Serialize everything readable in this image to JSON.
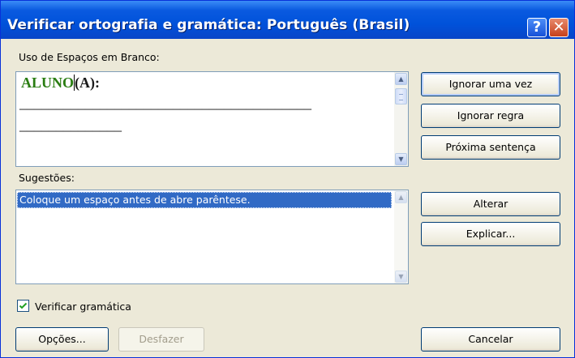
{
  "window": {
    "title": "Verificar ortografia e gramática: Português (Brasil)",
    "help_glyph": "?",
    "close_glyph": "✕"
  },
  "whitespace_section": {
    "label": "Uso de Espaços em Branco:",
    "text_word": "ALUNO",
    "text_rest": "(A):",
    "line1": "________________________________________",
    "line2": "______________"
  },
  "suggestions": {
    "label": "Sugestões:",
    "items": [
      "Coloque um espaço antes de abre parêntese."
    ]
  },
  "buttons": {
    "ignore_once": "Ignorar uma vez",
    "ignore_rule": "Ignorar regra",
    "next_sentence": "Próxima sentença",
    "change": "Alterar",
    "explain": "Explicar...",
    "options": "Opções...",
    "undo": "Desfazer",
    "cancel": "Cancelar"
  },
  "check_grammar": {
    "label": "Verificar gramática",
    "checked": true
  },
  "colors": {
    "title_bar": "#0a5ae0",
    "highlight": "#316ac5",
    "bold_green": "#2a7d12"
  }
}
